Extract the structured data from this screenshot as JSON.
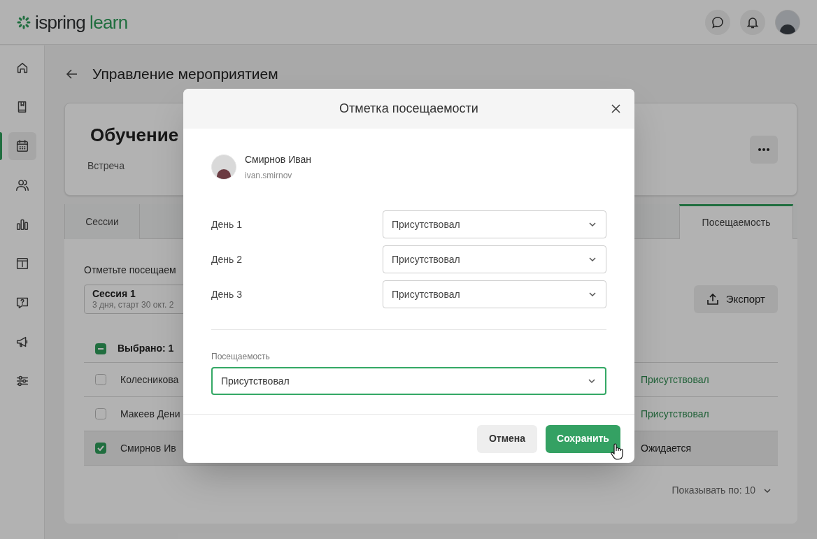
{
  "header": {
    "logo": [
      "ispring",
      "learn"
    ]
  },
  "sidebar": {
    "items": [
      {
        "selected": false
      },
      {
        "selected": false
      },
      {
        "selected": true
      },
      {
        "selected": false
      },
      {
        "selected": false
      },
      {
        "selected": false
      },
      {
        "selected": false
      },
      {
        "selected": false
      },
      {
        "selected": false
      }
    ]
  },
  "page": {
    "title": "Управление мероприятием"
  },
  "event_card": {
    "title": "Обучение",
    "type": "Встреча"
  },
  "tabs": [
    {
      "label": "Сессии",
      "selected": false
    },
    {
      "label": "Посещаемость",
      "selected": true
    }
  ],
  "attendance": {
    "hint": "Отметьте посещаем",
    "session": {
      "title": "Сессия 1",
      "subtitle": "3 дня, старт 30 окт. 2"
    },
    "export_button": "Экспорт",
    "select_all": {
      "label": "Выбрано: 1",
      "indeterminate": true
    },
    "rows": [
      {
        "name": "Колесникова",
        "checked": false,
        "status": "Присутствовал",
        "kind": "attended"
      },
      {
        "name": "Макеев Дени",
        "checked": false,
        "status": "Присутствовал",
        "kind": "attended"
      },
      {
        "name": "Смирнов Ив",
        "checked": true,
        "status": "Ожидается",
        "kind": "pending"
      }
    ],
    "page_size": "Показывать по: 10"
  },
  "dialog": {
    "title": "Отметка посещаемости",
    "user": {
      "name": "Смирнов Иван",
      "login": "ivan.smirnov"
    },
    "days": [
      {
        "label": "День 1",
        "value": "Присутствовал"
      },
      {
        "label": "День 2",
        "value": "Присутствовал"
      },
      {
        "label": "День 3",
        "value": "Присутствовал"
      }
    ],
    "overall": {
      "label": "Посещаемость",
      "value": "Присутствовал",
      "focused": true
    },
    "buttons": [
      {
        "label": "Отмена",
        "kind": "secondary"
      },
      {
        "label": "Сохранить",
        "kind": "primary"
      }
    ]
  }
}
